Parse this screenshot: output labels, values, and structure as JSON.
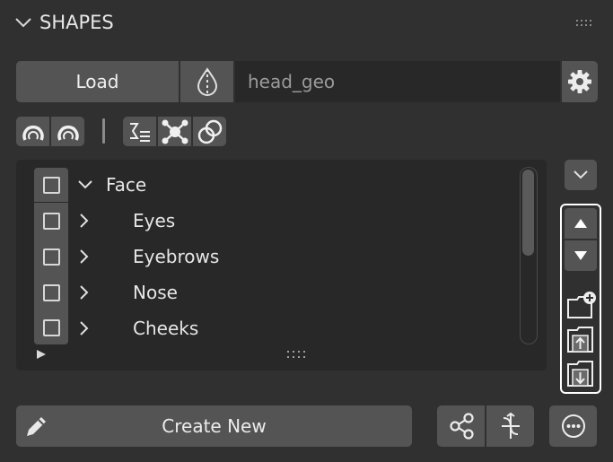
{
  "panel": {
    "title": "SHAPES"
  },
  "toolbar": {
    "load_label": "Load",
    "object_name": "head_geo"
  },
  "tree": {
    "items": [
      {
        "label": "Face",
        "expanded": true,
        "checked": false
      },
      {
        "label": "Eyes",
        "expanded": false,
        "checked": false
      },
      {
        "label": "Eyebrows",
        "expanded": false,
        "checked": false
      },
      {
        "label": "Nose",
        "expanded": false,
        "checked": false
      },
      {
        "label": "Cheeks",
        "expanded": false,
        "checked": false
      }
    ]
  },
  "footer": {
    "create_label": "Create New"
  },
  "colors": {
    "panel_bg": "#303030",
    "button": "#545454",
    "field": "#282828",
    "highlight": "#ffffff"
  }
}
